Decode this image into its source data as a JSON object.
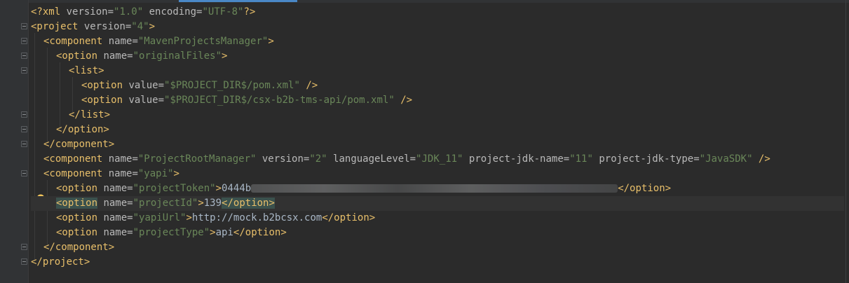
{
  "editor": {
    "theme_colors": {
      "background": "#2b2b2b",
      "tag": "#e8bf6a",
      "attribute": "#bababa",
      "attribute_value": "#6a8759",
      "text": "#a9b7c6",
      "tab_indicator": "#4a88c7"
    },
    "lines": {
      "l1": {
        "pi_open": "<?xml",
        "attr1": " version=",
        "val1": "\"1.0\"",
        "attr2": " encoding=",
        "val2": "\"UTF-8\"",
        "pi_close": "?>"
      },
      "l2": {
        "open": "<project",
        "attr": " version=",
        "val": "\"4\"",
        "close": ">"
      },
      "l3": {
        "open": "<component",
        "attr": " name=",
        "val": "\"MavenProjectsManager\"",
        "close": ">"
      },
      "l4": {
        "open": "<option",
        "attr": " name=",
        "val": "\"originalFiles\"",
        "close": ">"
      },
      "l5": {
        "tag": "<list>"
      },
      "l6": {
        "open": "<option",
        "attr": " value=",
        "val": "\"$PROJECT_DIR$/pom.xml\"",
        "close": " />"
      },
      "l7": {
        "open": "<option",
        "attr": " value=",
        "val": "\"$PROJECT_DIR$/csx-b2b-tms-api/pom.xml\"",
        "close": " />"
      },
      "l8": {
        "tag": "</list>"
      },
      "l9": {
        "tag": "</option>"
      },
      "l10": {
        "tag": "</component>"
      },
      "l11": {
        "open": "<component",
        "attr1": " name=",
        "val1": "\"ProjectRootManager\"",
        "attr2": " version=",
        "val2": "\"2\"",
        "attr3": " languageLevel=",
        "val3": "\"JDK_11\"",
        "attr4": " project-jdk-name=",
        "val4": "\"11\"",
        "attr5": " project-jdk-type=",
        "val5": "\"JavaSDK\"",
        "close": " />"
      },
      "l12": {
        "open": "<component",
        "attr": " name=",
        "val": "\"yapi\"",
        "close": ">"
      },
      "l13": {
        "open": "<option",
        "attr": " name=",
        "val": "\"projectToken\"",
        "close": ">",
        "text_visible": "0444b",
        "end": "</option>"
      },
      "l14": {
        "open": "<option",
        "attr": " name=",
        "val": "\"projectId\"",
        "close": ">",
        "text": "139",
        "end": "</option>"
      },
      "l15": {
        "open": "<option",
        "attr": " name=",
        "val": "\"yapiUrl\"",
        "close": ">",
        "text": "http://mock.b2bcsx.com",
        "end": "</option>"
      },
      "l16": {
        "open": "<option",
        "attr": " name=",
        "val": "\"projectType\"",
        "close": ">",
        "text": "api",
        "end": "</option>"
      },
      "l17": {
        "tag": "</component>"
      },
      "l18": {
        "tag": "</project>"
      }
    },
    "gutter_icons": {
      "intention": "lightbulb-icon"
    }
  }
}
